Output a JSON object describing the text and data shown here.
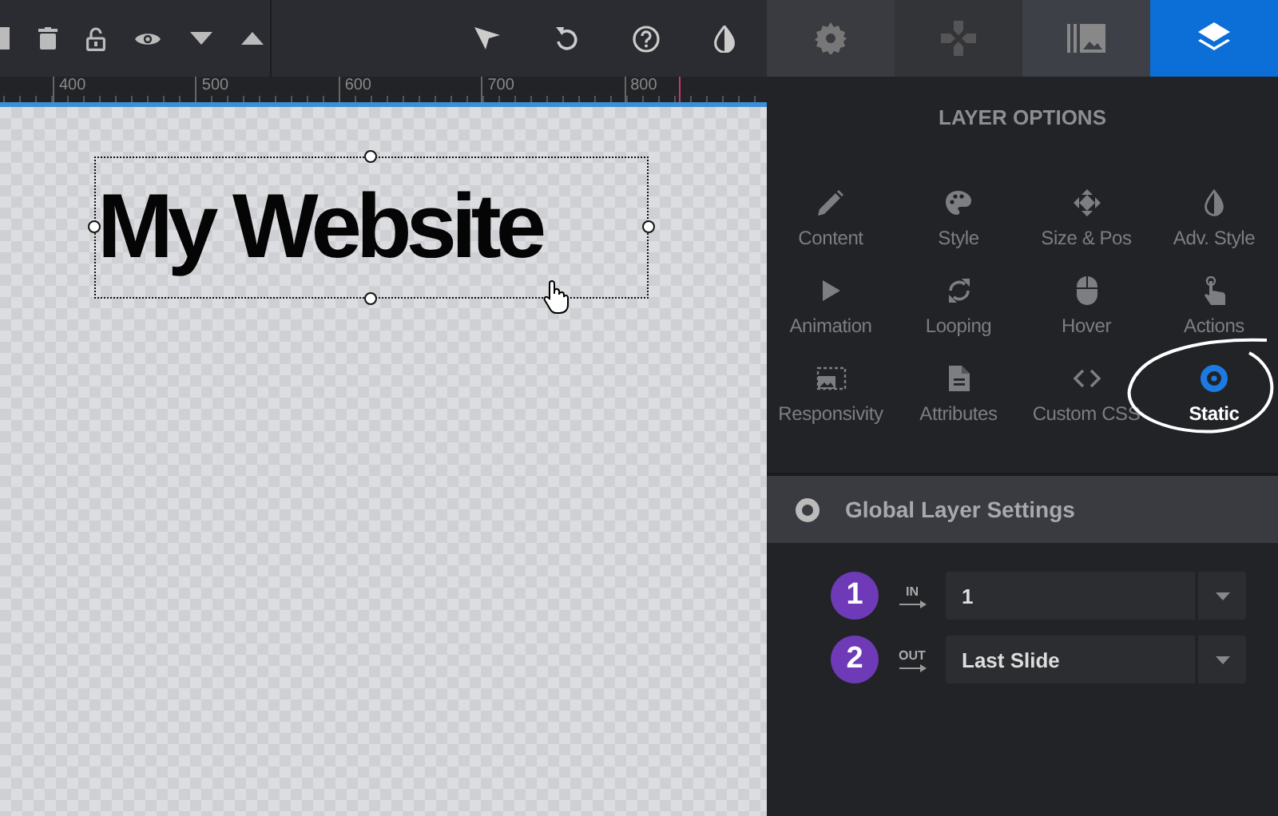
{
  "ruler": {
    "marks": [
      "400",
      "500",
      "600",
      "700",
      "800"
    ]
  },
  "canvas": {
    "layer_text": "My Website"
  },
  "panel_tabs": [
    {
      "kind": "gear",
      "selected": false
    },
    {
      "kind": "gamepad",
      "selected": false
    },
    {
      "kind": "media",
      "selected": false
    },
    {
      "kind": "layers",
      "selected": true
    }
  ],
  "panel": {
    "title": "LAYER OPTIONS",
    "options": [
      {
        "kind": "pencil",
        "label": "Content",
        "selected": false
      },
      {
        "kind": "palette",
        "label": "Style",
        "selected": false
      },
      {
        "kind": "move",
        "label": "Size & Pos",
        "selected": false
      },
      {
        "kind": "drop",
        "label": "Adv. Style",
        "selected": false
      },
      {
        "kind": "play",
        "label": "Animation",
        "selected": false
      },
      {
        "kind": "loop",
        "label": "Looping",
        "selected": false
      },
      {
        "kind": "mouse",
        "label": "Hover",
        "selected": false
      },
      {
        "kind": "finger",
        "label": "Actions",
        "selected": false
      },
      {
        "kind": "frame",
        "label": "Responsivity",
        "selected": false
      },
      {
        "kind": "file",
        "label": "Attributes",
        "selected": false
      },
      {
        "kind": "code",
        "label": "Custom CSS",
        "selected": false
      },
      {
        "kind": "target",
        "label": "Static",
        "selected": true
      }
    ],
    "section": {
      "title": "Global Layer Settings"
    },
    "rows": [
      {
        "badge": "1",
        "direction": "IN",
        "value": "1"
      },
      {
        "badge": "2",
        "direction": "OUT",
        "value": "Last Slide"
      }
    ]
  }
}
